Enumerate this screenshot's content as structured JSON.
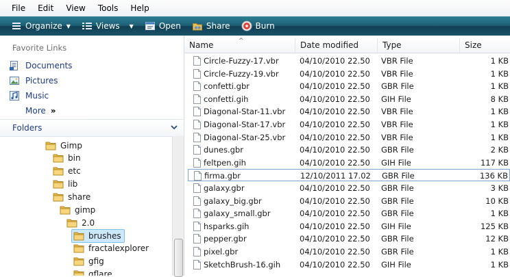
{
  "menu": [
    "File",
    "Edit",
    "View",
    "Tools",
    "Help"
  ],
  "toolbar": {
    "organize": "Organize",
    "views": "Views",
    "open": "Open",
    "share": "Share",
    "burn": "Burn"
  },
  "sidebar": {
    "favorites_title": "Favorite Links",
    "links": [
      "Documents",
      "Pictures",
      "Music"
    ],
    "more": "More",
    "more_glyph": "»",
    "folders_title": "Folders"
  },
  "tree": [
    "Gimp",
    "bin",
    "etc",
    "lib",
    "share",
    "gimp",
    "2.0",
    "brushes",
    "fractalexplorer",
    "gfig",
    "gflare"
  ],
  "columns": {
    "name": "Name",
    "date": "Date modified",
    "type": "Type",
    "size": "Size"
  },
  "files": [
    {
      "name": "Circle-Fuzzy-17.vbr",
      "date": "04/10/2010 22.50",
      "type": "VBR File",
      "size": "1 KB"
    },
    {
      "name": "Circle-Fuzzy-19.vbr",
      "date": "04/10/2010 22.50",
      "type": "VBR File",
      "size": "1 KB"
    },
    {
      "name": "confetti.gbr",
      "date": "04/10/2010 22.50",
      "type": "GBR File",
      "size": "1 KB"
    },
    {
      "name": "confetti.gih",
      "date": "04/10/2010 22.50",
      "type": "GIH File",
      "size": "8 KB"
    },
    {
      "name": "Diagonal-Star-11.vbr",
      "date": "04/10/2010 22.50",
      "type": "VBR File",
      "size": "1 KB"
    },
    {
      "name": "Diagonal-Star-17.vbr",
      "date": "04/10/2010 22.50",
      "type": "VBR File",
      "size": "1 KB"
    },
    {
      "name": "Diagonal-Star-25.vbr",
      "date": "04/10/2010 22.50",
      "type": "VBR File",
      "size": "1 KB"
    },
    {
      "name": "dunes.gbr",
      "date": "04/10/2010 22.50",
      "type": "GBR File",
      "size": "2 KB"
    },
    {
      "name": "feltpen.gih",
      "date": "04/10/2010 22.50",
      "type": "GIH File",
      "size": "117 KB"
    },
    {
      "name": "firma.gbr",
      "date": "12/10/2011 17.02",
      "type": "GBR File",
      "size": "136 KB"
    },
    {
      "name": "galaxy.gbr",
      "date": "04/10/2010 22.50",
      "type": "GBR File",
      "size": "3 KB"
    },
    {
      "name": "galaxy_big.gbr",
      "date": "04/10/2010 22.50",
      "type": "GBR File",
      "size": "10 KB"
    },
    {
      "name": "galaxy_small.gbr",
      "date": "04/10/2010 22.50",
      "type": "GBR File",
      "size": "1 KB"
    },
    {
      "name": "hsparks.gih",
      "date": "04/10/2010 22.50",
      "type": "GIH File",
      "size": "125 KB"
    },
    {
      "name": "pepper.gbr",
      "date": "04/10/2010 22.50",
      "type": "GBR File",
      "size": "12 KB"
    },
    {
      "name": "pixel.gbr",
      "date": "04/10/2010 22.50",
      "type": "GBR File",
      "size": "1 KB"
    },
    {
      "name": "SketchBrush-16.gih",
      "date": "04/10/2010 22.50",
      "type": "GIH File",
      "size": "1 KB"
    }
  ],
  "colors": {
    "toolbar": "#1d5e74",
    "link": "#1e3b8a",
    "folder": "#e8b948",
    "selection": "#cde8fb"
  }
}
